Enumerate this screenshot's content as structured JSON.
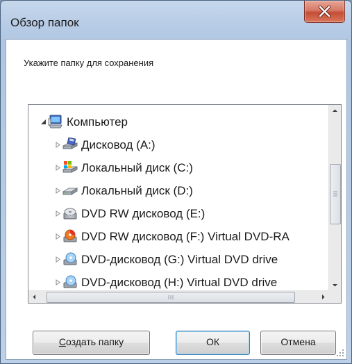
{
  "window": {
    "title": "Обзор папок"
  },
  "prompt": "Укажите папку для сохранения",
  "tree": {
    "root": {
      "label": "Компьютер",
      "icon": "computer-icon",
      "expanded": true
    },
    "items": [
      {
        "label": "Дисковод (A:)",
        "icon": "floppy-drive-icon"
      },
      {
        "label": "Локальный диск (C:)",
        "icon": "system-drive-icon"
      },
      {
        "label": "Локальный диск (D:)",
        "icon": "hard-drive-icon"
      },
      {
        "label": "DVD RW дисковод (E:)",
        "icon": "dvd-rw-drive-icon"
      },
      {
        "label": "DVD RW дисковод (F:) Virtual DVD-RA",
        "icon": "dvd-rw-drive-icon"
      },
      {
        "label": "DVD-дисковод (G:) Virtual DVD drive",
        "icon": "dvd-drive-icon"
      },
      {
        "label": "DVD-дисковод (H:) Virtual DVD drive",
        "icon": "dvd-drive-icon"
      }
    ]
  },
  "buttons": {
    "new_folder_underline": "С",
    "new_folder_rest": "оздать папку",
    "ok": "ОК",
    "cancel": "Отмена"
  },
  "colors": {
    "close_button": "#c44d35",
    "default_button_border": "#3c7fb1"
  }
}
